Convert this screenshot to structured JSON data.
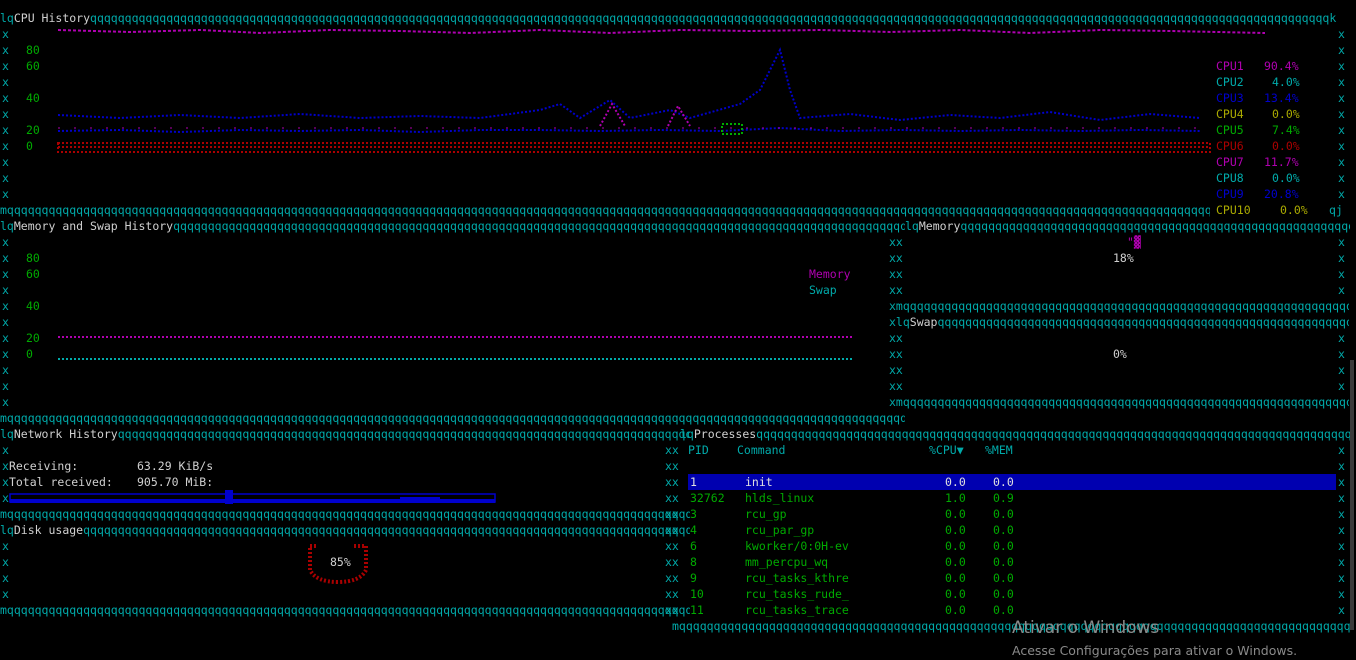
{
  "panels": {
    "cpu_title": "CPU History",
    "mem_title": "Memory and Swap History",
    "memory_title": "Memory",
    "swap_title": "Swap",
    "network_title": "Network History",
    "disk_title": "Disk usage",
    "processes_title": "Processes"
  },
  "cpu_axis": [
    "80",
    "60",
    "40",
    "20",
    "0"
  ],
  "cpu_legend": [
    {
      "name": "CPU1",
      "value": "90.4%",
      "color": "#b000b0"
    },
    {
      "name": "CPU2",
      "value": "4.0%",
      "color": "#00aaaa"
    },
    {
      "name": "CPU3",
      "value": "13.4%",
      "color": "#0000cc"
    },
    {
      "name": "CPU4",
      "value": "0.0%",
      "color": "#aaaa00"
    },
    {
      "name": "CPU5",
      "value": "7.4%",
      "color": "#00aa00"
    },
    {
      "name": "CPU6",
      "value": "0.0%",
      "color": "#aa0000"
    },
    {
      "name": "CPU7",
      "value": "11.7%",
      "color": "#b000b0"
    },
    {
      "name": "CPU8",
      "value": "0.0%",
      "color": "#00aaaa"
    },
    {
      "name": "CPU9",
      "value": "20.8%",
      "color": "#0000cc"
    },
    {
      "name": "CPU10",
      "value": "0.0%",
      "color": "#aaaa00"
    }
  ],
  "mem_axis": [
    "80",
    "60",
    "40",
    "20",
    "0"
  ],
  "mem_legend": {
    "memory": "Memory",
    "swap": "Swap",
    "memory_color": "#b000b0",
    "swap_color": "#00aaaa"
  },
  "memory_percent": "18%",
  "swap_percent": "0%",
  "network": {
    "receiving_label": "Receiving:",
    "receiving_value": "63.29 KiB/s",
    "total_label": "Total received:",
    "total_value": "905.70 MiB:"
  },
  "disk_percent": "85%",
  "process_headers": {
    "pid": "PID",
    "command": "Command",
    "cpu": "%CPU▼",
    "mem": "%MEM"
  },
  "processes": [
    {
      "pid": "1",
      "command": "init",
      "cpu": "0.0",
      "mem": "0.0"
    },
    {
      "pid": "32762",
      "command": "hlds_linux",
      "cpu": "1.0",
      "mem": "0.9"
    },
    {
      "pid": "3",
      "command": "rcu_gp",
      "cpu": "0.0",
      "mem": "0.0"
    },
    {
      "pid": "4",
      "command": "rcu_par_gp",
      "cpu": "0.0",
      "mem": "0.0"
    },
    {
      "pid": "6",
      "command": "kworker/0:0H-ev",
      "cpu": "0.0",
      "mem": "0.0"
    },
    {
      "pid": "8",
      "command": "mm_percpu_wq",
      "cpu": "0.0",
      "mem": "0.0"
    },
    {
      "pid": "9",
      "command": "rcu_tasks_kthre",
      "cpu": "0.0",
      "mem": "0.0"
    },
    {
      "pid": "10",
      "command": "rcu_tasks_rude_",
      "cpu": "0.0",
      "mem": "0.0"
    },
    {
      "pid": "11",
      "command": "rcu_tasks_trace",
      "cpu": "0.0",
      "mem": "0.0"
    }
  ],
  "watermark": {
    "line1": "Ativar o Windows",
    "line2": "Acesse Configurações para ativar o Windows."
  }
}
